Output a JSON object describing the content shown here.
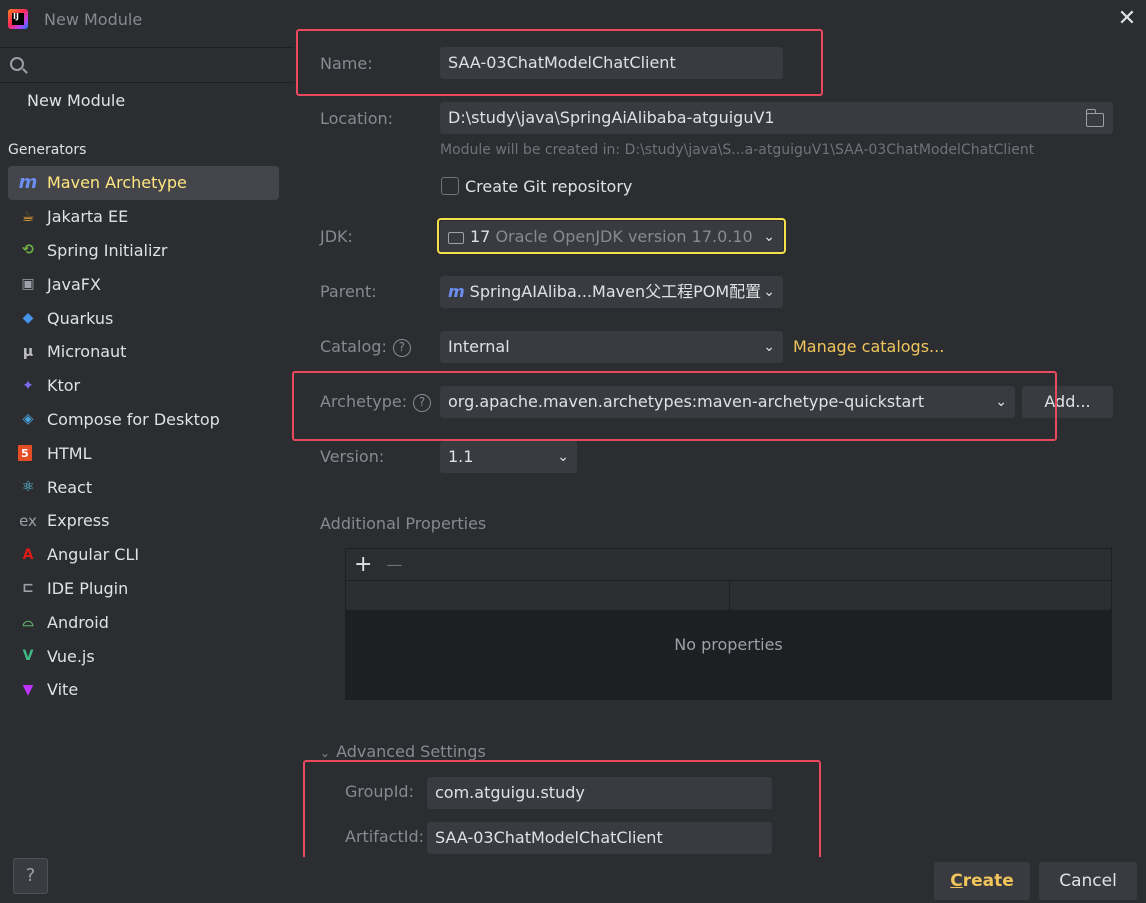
{
  "window": {
    "title": "New Module",
    "logo_text": "IJ"
  },
  "sidebar": {
    "search_placeholder": "",
    "top_item": "New Module",
    "section_label": "Generators",
    "items": [
      {
        "label": "Maven Archetype",
        "icon": "maven-icon",
        "glyph": "m",
        "color": "#6b8ef0",
        "selected": true
      },
      {
        "label": "Jakarta EE",
        "icon": "jakarta-icon",
        "glyph": "☕",
        "color": "#f2a93b",
        "selected": false
      },
      {
        "label": "Spring Initializr",
        "icon": "spring-icon",
        "glyph": "⟲",
        "color": "#6cb043",
        "selected": false
      },
      {
        "label": "JavaFX",
        "icon": "javafx-icon",
        "glyph": "▣",
        "color": "#9da0a8",
        "selected": false
      },
      {
        "label": "Quarkus",
        "icon": "quarkus-icon",
        "glyph": "◆",
        "color": "#4695eb",
        "selected": false
      },
      {
        "label": "Micronaut",
        "icon": "micronaut-icon",
        "glyph": "μ",
        "color": "#bfbfbf",
        "selected": false
      },
      {
        "label": "Ktor",
        "icon": "ktor-icon",
        "glyph": "✦",
        "color": "#7f6bf2",
        "selected": false
      },
      {
        "label": "Compose for Desktop",
        "icon": "compose-icon",
        "glyph": "◈",
        "color": "#4aa5e0",
        "selected": false
      },
      {
        "label": "HTML",
        "icon": "html5-icon",
        "glyph": "5",
        "color": "#e44d26",
        "selected": false
      },
      {
        "label": "React",
        "icon": "react-icon",
        "glyph": "⚛",
        "color": "#61dafb",
        "selected": false
      },
      {
        "label": "Express",
        "icon": "express-icon",
        "glyph": "ex",
        "color": "#9da0a8",
        "selected": false
      },
      {
        "label": "Angular CLI",
        "icon": "angular-icon",
        "glyph": "A",
        "color": "#dd1b16",
        "selected": false
      },
      {
        "label": "IDE Plugin",
        "icon": "plugin-icon",
        "glyph": "⊏",
        "color": "#9da0a8",
        "selected": false
      },
      {
        "label": "Android",
        "icon": "android-icon",
        "glyph": "⌓",
        "color": "#5fb370",
        "selected": false
      },
      {
        "label": "Vue.js",
        "icon": "vue-icon",
        "glyph": "V",
        "color": "#41b883",
        "selected": false
      },
      {
        "label": "Vite",
        "icon": "vite-icon",
        "glyph": "▼",
        "color": "#bd34fe",
        "selected": false
      }
    ],
    "help_label": "?"
  },
  "form": {
    "name": {
      "label": "Name:",
      "value": "SAA-03ChatModelChatClient"
    },
    "location": {
      "label": "Location:",
      "value": "D:\\study\\java\\SpringAiAlibaba-atguiguV1",
      "hint": "Module will be created in: D:\\study\\java\\S...a-atguiguV1\\SAA-03ChatModelChatClient"
    },
    "git": {
      "label": "Create Git repository",
      "checked": false
    },
    "jdk": {
      "label": "JDK:",
      "version": "17",
      "value": "Oracle OpenJDK version 17.0.10"
    },
    "parent": {
      "label": "Parent:",
      "value": "SpringAIAliba...Maven父工程POM配置"
    },
    "catalog": {
      "label": "Catalog:",
      "value": "Internal",
      "manage_link": "Manage catalogs..."
    },
    "archetype": {
      "label": "Archetype:",
      "value": "org.apache.maven.archetypes:maven-archetype-quickstart",
      "add_button": "Add..."
    },
    "version": {
      "label": "Version:",
      "value": "1.1"
    },
    "additional_properties": {
      "label": "Additional Properties",
      "add": "+",
      "remove": "—",
      "empty_text": "No properties"
    },
    "advanced": {
      "label": "Advanced Settings",
      "group_id_label": "GroupId:",
      "group_id": "com.atguigu.study",
      "artifact_id_label": "ArtifactId:",
      "artifact_id": "SAA-03ChatModelChatClient"
    }
  },
  "footer": {
    "create_label": "Create",
    "create_mnemonic": "C",
    "create_rest": "reate",
    "cancel_label": "Cancel"
  }
}
